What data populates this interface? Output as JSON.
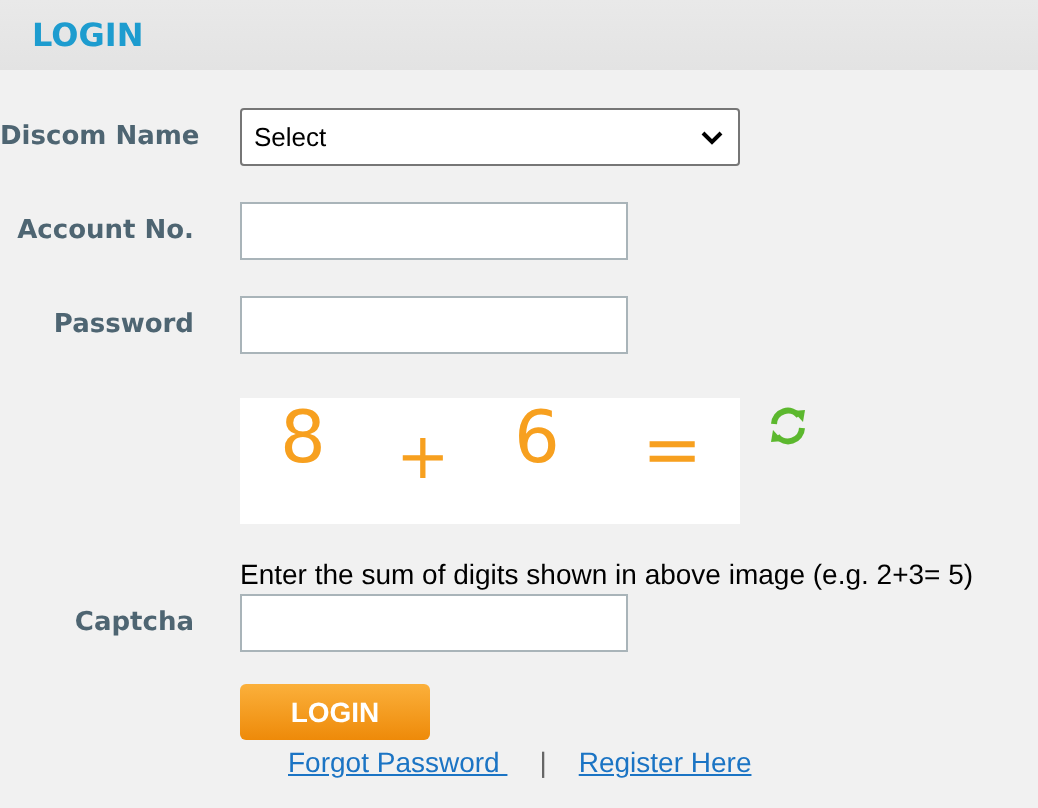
{
  "header": {
    "title": "LOGIN"
  },
  "fields": [
    {
      "kind": "select",
      "label": "Discom Name",
      "value": "Select"
    },
    {
      "kind": "text",
      "label": "Account No."
    },
    {
      "kind": "password",
      "label": "Password"
    }
  ],
  "captcha": {
    "characters": [
      "8",
      "+",
      "6",
      "="
    ],
    "hint": "Enter the sum of digits shown in above image (e.g. 2+3= 5)",
    "label": "Captcha"
  },
  "login_button": "LOGIN",
  "links": [
    {
      "label": "Forgot Password "
    },
    {
      "label": "Register Here"
    }
  ],
  "link_separator": "|"
}
